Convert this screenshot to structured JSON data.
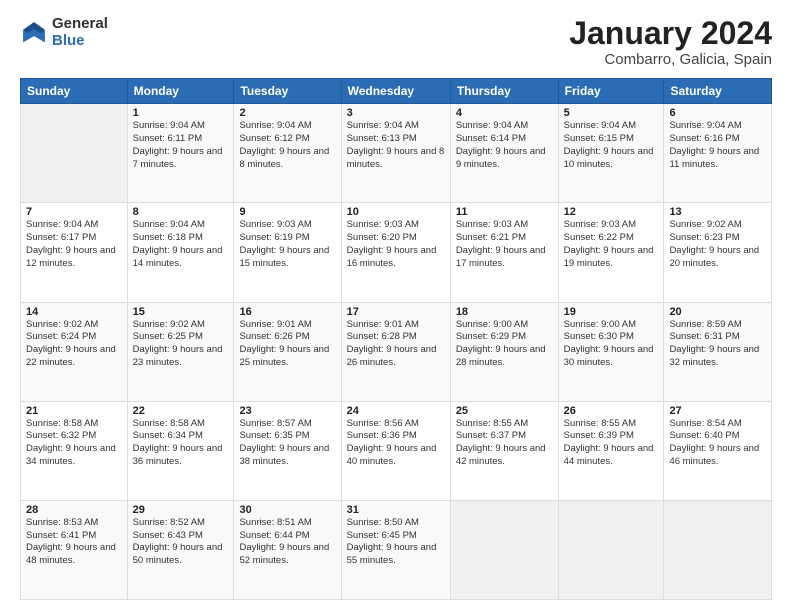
{
  "logo": {
    "general": "General",
    "blue": "Blue"
  },
  "title": "January 2024",
  "subtitle": "Combarro, Galicia, Spain",
  "days_header": [
    "Sunday",
    "Monday",
    "Tuesday",
    "Wednesday",
    "Thursday",
    "Friday",
    "Saturday"
  ],
  "weeks": [
    [
      {
        "day": "",
        "sunrise": "",
        "sunset": "",
        "daylight": ""
      },
      {
        "day": "1",
        "sunrise": "Sunrise: 9:04 AM",
        "sunset": "Sunset: 6:11 PM",
        "daylight": "Daylight: 9 hours and 7 minutes."
      },
      {
        "day": "2",
        "sunrise": "Sunrise: 9:04 AM",
        "sunset": "Sunset: 6:12 PM",
        "daylight": "Daylight: 9 hours and 8 minutes."
      },
      {
        "day": "3",
        "sunrise": "Sunrise: 9:04 AM",
        "sunset": "Sunset: 6:13 PM",
        "daylight": "Daylight: 9 hours and 8 minutes."
      },
      {
        "day": "4",
        "sunrise": "Sunrise: 9:04 AM",
        "sunset": "Sunset: 6:14 PM",
        "daylight": "Daylight: 9 hours and 9 minutes."
      },
      {
        "day": "5",
        "sunrise": "Sunrise: 9:04 AM",
        "sunset": "Sunset: 6:15 PM",
        "daylight": "Daylight: 9 hours and 10 minutes."
      },
      {
        "day": "6",
        "sunrise": "Sunrise: 9:04 AM",
        "sunset": "Sunset: 6:16 PM",
        "daylight": "Daylight: 9 hours and 11 minutes."
      }
    ],
    [
      {
        "day": "7",
        "sunrise": "Sunrise: 9:04 AM",
        "sunset": "Sunset: 6:17 PM",
        "daylight": "Daylight: 9 hours and 12 minutes."
      },
      {
        "day": "8",
        "sunrise": "Sunrise: 9:04 AM",
        "sunset": "Sunset: 6:18 PM",
        "daylight": "Daylight: 9 hours and 14 minutes."
      },
      {
        "day": "9",
        "sunrise": "Sunrise: 9:03 AM",
        "sunset": "Sunset: 6:19 PM",
        "daylight": "Daylight: 9 hours and 15 minutes."
      },
      {
        "day": "10",
        "sunrise": "Sunrise: 9:03 AM",
        "sunset": "Sunset: 6:20 PM",
        "daylight": "Daylight: 9 hours and 16 minutes."
      },
      {
        "day": "11",
        "sunrise": "Sunrise: 9:03 AM",
        "sunset": "Sunset: 6:21 PM",
        "daylight": "Daylight: 9 hours and 17 minutes."
      },
      {
        "day": "12",
        "sunrise": "Sunrise: 9:03 AM",
        "sunset": "Sunset: 6:22 PM",
        "daylight": "Daylight: 9 hours and 19 minutes."
      },
      {
        "day": "13",
        "sunrise": "Sunrise: 9:02 AM",
        "sunset": "Sunset: 6:23 PM",
        "daylight": "Daylight: 9 hours and 20 minutes."
      }
    ],
    [
      {
        "day": "14",
        "sunrise": "Sunrise: 9:02 AM",
        "sunset": "Sunset: 6:24 PM",
        "daylight": "Daylight: 9 hours and 22 minutes."
      },
      {
        "day": "15",
        "sunrise": "Sunrise: 9:02 AM",
        "sunset": "Sunset: 6:25 PM",
        "daylight": "Daylight: 9 hours and 23 minutes."
      },
      {
        "day": "16",
        "sunrise": "Sunrise: 9:01 AM",
        "sunset": "Sunset: 6:26 PM",
        "daylight": "Daylight: 9 hours and 25 minutes."
      },
      {
        "day": "17",
        "sunrise": "Sunrise: 9:01 AM",
        "sunset": "Sunset: 6:28 PM",
        "daylight": "Daylight: 9 hours and 26 minutes."
      },
      {
        "day": "18",
        "sunrise": "Sunrise: 9:00 AM",
        "sunset": "Sunset: 6:29 PM",
        "daylight": "Daylight: 9 hours and 28 minutes."
      },
      {
        "day": "19",
        "sunrise": "Sunrise: 9:00 AM",
        "sunset": "Sunset: 6:30 PM",
        "daylight": "Daylight: 9 hours and 30 minutes."
      },
      {
        "day": "20",
        "sunrise": "Sunrise: 8:59 AM",
        "sunset": "Sunset: 6:31 PM",
        "daylight": "Daylight: 9 hours and 32 minutes."
      }
    ],
    [
      {
        "day": "21",
        "sunrise": "Sunrise: 8:58 AM",
        "sunset": "Sunset: 6:32 PM",
        "daylight": "Daylight: 9 hours and 34 minutes."
      },
      {
        "day": "22",
        "sunrise": "Sunrise: 8:58 AM",
        "sunset": "Sunset: 6:34 PM",
        "daylight": "Daylight: 9 hours and 36 minutes."
      },
      {
        "day": "23",
        "sunrise": "Sunrise: 8:57 AM",
        "sunset": "Sunset: 6:35 PM",
        "daylight": "Daylight: 9 hours and 38 minutes."
      },
      {
        "day": "24",
        "sunrise": "Sunrise: 8:56 AM",
        "sunset": "Sunset: 6:36 PM",
        "daylight": "Daylight: 9 hours and 40 minutes."
      },
      {
        "day": "25",
        "sunrise": "Sunrise: 8:55 AM",
        "sunset": "Sunset: 6:37 PM",
        "daylight": "Daylight: 9 hours and 42 minutes."
      },
      {
        "day": "26",
        "sunrise": "Sunrise: 8:55 AM",
        "sunset": "Sunset: 6:39 PM",
        "daylight": "Daylight: 9 hours and 44 minutes."
      },
      {
        "day": "27",
        "sunrise": "Sunrise: 8:54 AM",
        "sunset": "Sunset: 6:40 PM",
        "daylight": "Daylight: 9 hours and 46 minutes."
      }
    ],
    [
      {
        "day": "28",
        "sunrise": "Sunrise: 8:53 AM",
        "sunset": "Sunset: 6:41 PM",
        "daylight": "Daylight: 9 hours and 48 minutes."
      },
      {
        "day": "29",
        "sunrise": "Sunrise: 8:52 AM",
        "sunset": "Sunset: 6:43 PM",
        "daylight": "Daylight: 9 hours and 50 minutes."
      },
      {
        "day": "30",
        "sunrise": "Sunrise: 8:51 AM",
        "sunset": "Sunset: 6:44 PM",
        "daylight": "Daylight: 9 hours and 52 minutes."
      },
      {
        "day": "31",
        "sunrise": "Sunrise: 8:50 AM",
        "sunset": "Sunset: 6:45 PM",
        "daylight": "Daylight: 9 hours and 55 minutes."
      },
      {
        "day": "",
        "sunrise": "",
        "sunset": "",
        "daylight": ""
      },
      {
        "day": "",
        "sunrise": "",
        "sunset": "",
        "daylight": ""
      },
      {
        "day": "",
        "sunrise": "",
        "sunset": "",
        "daylight": ""
      }
    ]
  ]
}
